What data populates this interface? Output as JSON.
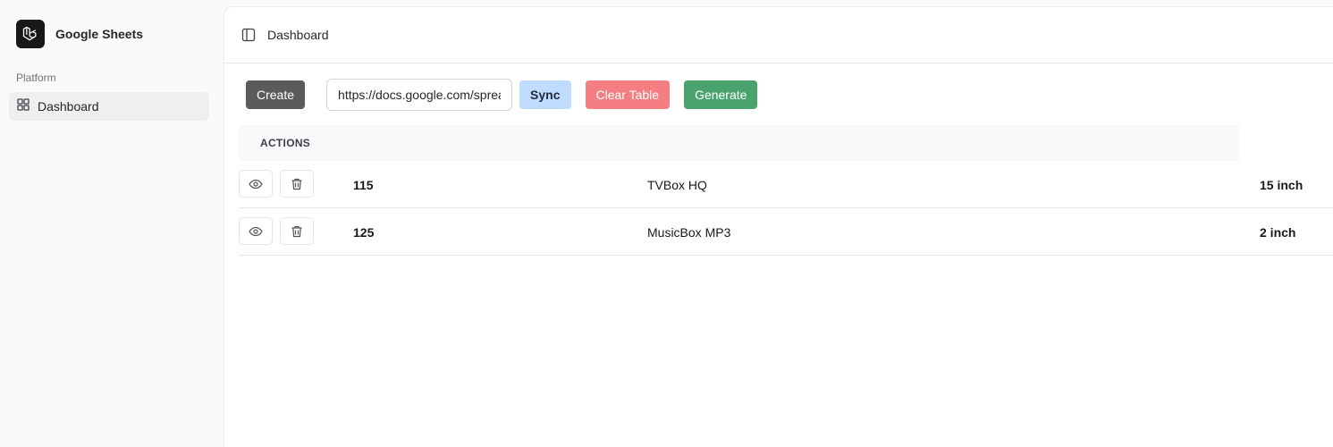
{
  "brand": {
    "name": "Google Sheets",
    "icon": "laravel-logo-icon"
  },
  "sidebar": {
    "group_label": "Platform",
    "items": [
      {
        "label": "Dashboard",
        "icon": "grid-icon",
        "active": true
      }
    ]
  },
  "header": {
    "breadcrumb": "Dashboard",
    "toggle_icon": "sidebar-toggle-icon"
  },
  "toolbar": {
    "create_label": "Create",
    "url_value": "https://docs.google.com/spreadsheets",
    "sync_label": "Sync",
    "clear_label": "Clear Table",
    "generate_label": "Generate"
  },
  "table": {
    "headers": [
      "ACTIONS"
    ],
    "rows": [
      {
        "id": "115",
        "name": "TVBox HQ",
        "size": "15 inch"
      },
      {
        "id": "125",
        "name": "MusicBox MP3",
        "size": "2 inch"
      }
    ],
    "row_action_icons": [
      "eye-icon",
      "trash-icon"
    ]
  },
  "colors": {
    "create": "#5b5b5b",
    "sync": "#bfdbfe",
    "clear": "#f47e82",
    "generate": "#4aa36c"
  }
}
